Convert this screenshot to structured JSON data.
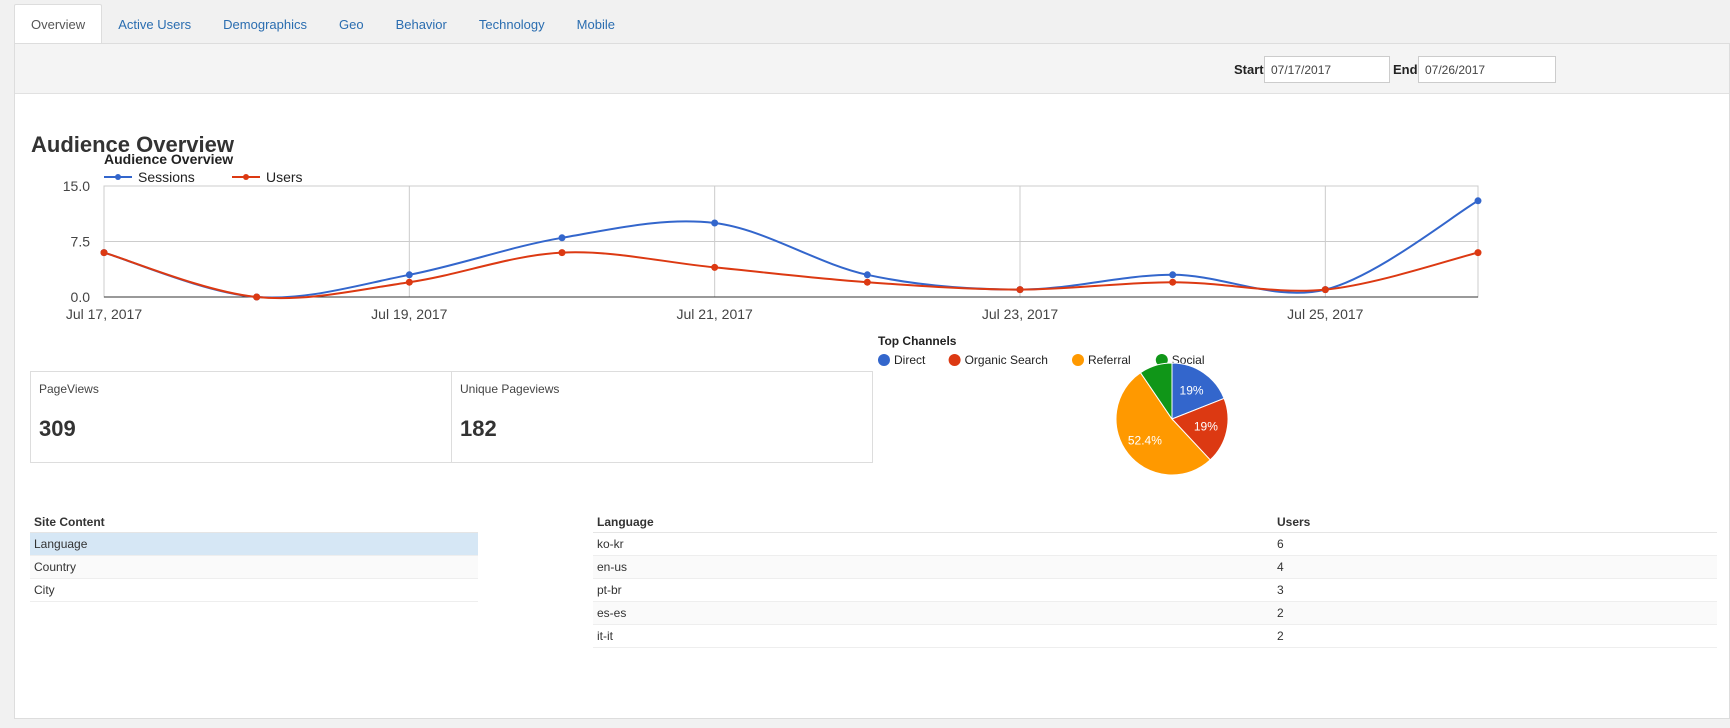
{
  "tabs": [
    {
      "label": "Overview",
      "active": true
    },
    {
      "label": "Active Users"
    },
    {
      "label": "Demographics"
    },
    {
      "label": "Geo"
    },
    {
      "label": "Behavior"
    },
    {
      "label": "Technology"
    },
    {
      "label": "Mobile"
    }
  ],
  "date_range": {
    "start_label": "Start",
    "start_value": "07/17/2017",
    "end_label": "End",
    "end_value": "07/26/2017"
  },
  "page_title": "Audience Overview",
  "stats": {
    "pageviews_label": "PageViews",
    "pageviews_value": "309",
    "unique_label": "Unique Pageviews",
    "unique_value": "182"
  },
  "site_content": {
    "header": "Site Content",
    "items": [
      "Language",
      "Country",
      "City"
    ],
    "selected": "Language"
  },
  "language_table": {
    "columns": [
      "Language",
      "Users"
    ],
    "rows": [
      [
        "ko-kr",
        "6"
      ],
      [
        "en-us",
        "4"
      ],
      [
        "pt-br",
        "3"
      ],
      [
        "es-es",
        "2"
      ],
      [
        "it-it",
        "2"
      ]
    ]
  },
  "chart_data": [
    {
      "type": "line",
      "title": "Audience Overview",
      "x": [
        "Jul 17, 2017",
        "Jul 18, 2017",
        "Jul 19, 2017",
        "Jul 20, 2017",
        "Jul 21, 2017",
        "Jul 22, 2017",
        "Jul 23, 2017",
        "Jul 24, 2017",
        "Jul 25, 2017",
        "Jul 26, 2017"
      ],
      "x_tick_labels": [
        "Jul 17, 2017",
        "Jul 19, 2017",
        "Jul 21, 2017",
        "Jul 23, 2017",
        "Jul 25, 2017"
      ],
      "y_tick_labels": [
        "0.0",
        "7.5",
        "15.0"
      ],
      "ylim": [
        0,
        15
      ],
      "series": [
        {
          "name": "Sessions",
          "color": "#3366cc",
          "values": [
            6,
            0,
            3,
            8,
            10,
            3,
            1,
            3,
            1,
            13
          ]
        },
        {
          "name": "Users",
          "color": "#dc3912",
          "values": [
            6,
            0,
            2,
            6,
            4,
            2,
            1,
            2,
            1,
            6
          ]
        }
      ],
      "legend": "top-left",
      "grid": true
    },
    {
      "type": "pie",
      "title": "Top Channels",
      "legend": "top",
      "slices": [
        {
          "label": "Direct",
          "value": 19.0,
          "display": "19%",
          "color": "#3366cc"
        },
        {
          "label": "Organic Search",
          "value": 19.0,
          "display": "19%",
          "color": "#dc3912"
        },
        {
          "label": "Referral",
          "value": 52.4,
          "display": "52.4%",
          "color": "#ff9900"
        },
        {
          "label": "Social",
          "value": 9.5,
          "display": "",
          "color": "#109618"
        }
      ]
    }
  ]
}
